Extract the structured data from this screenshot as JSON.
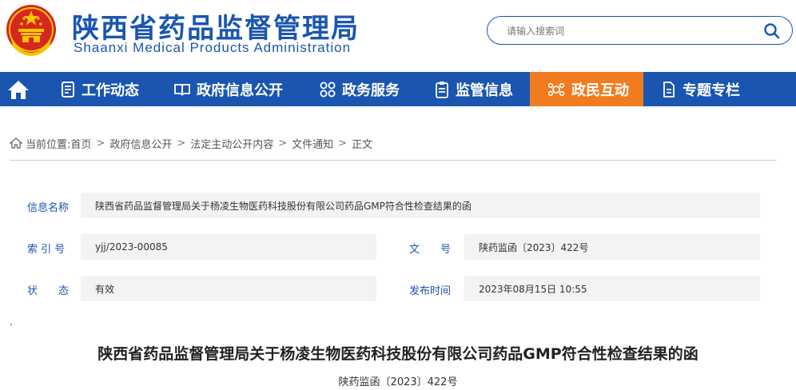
{
  "header": {
    "title": "陕西省药品监督管理局",
    "subtitle": "Shaanxi Medical Products Administration"
  },
  "search": {
    "placeholder": "请输入搜索词"
  },
  "nav": {
    "items": [
      {
        "label": "工作动态",
        "icon": "document-list-icon"
      },
      {
        "label": "政府信息公开",
        "icon": "open-book-icon"
      },
      {
        "label": "政务服务",
        "icon": "grid-circles-icon"
      },
      {
        "label": "监管信息",
        "icon": "clipboard-icon"
      },
      {
        "label": "政民互动",
        "icon": "interaction-icon"
      },
      {
        "label": "专题专栏",
        "icon": "page-icon"
      }
    ],
    "active_item": "政民互动"
  },
  "breadcrumb": {
    "prefix": "当前位置:",
    "items": [
      "首页",
      "政府信息公开",
      "法定主动公开内容",
      "文件通知",
      "正文"
    ],
    "separator": ">"
  },
  "info": {
    "name_label": "信息名称",
    "name_value": "陕西省药品监督管理局关于杨凌生物医药科技股份有限公司药品GMP符合性检查结果的函",
    "index_label": "索 引 号",
    "index_value": "yjj/2023-00085",
    "docno_label": "文　　号",
    "docno_value": "陕药监函〔2023〕422号",
    "status_label": "状　　态",
    "status_value": "有效",
    "date_label": "发布时间",
    "date_value": "2023年08月15日 10:55"
  },
  "marker": ".",
  "document": {
    "title": "陕西省药品监督管理局关于杨凌生物医药科技股份有限公司药品GMP符合性检查结果的函",
    "number": "陕药监函〔2023〕422号"
  },
  "colors": {
    "brand_blue": "#1a56b0",
    "active_orange": "#f07c1f",
    "label_bg": "#f3f3f3"
  }
}
